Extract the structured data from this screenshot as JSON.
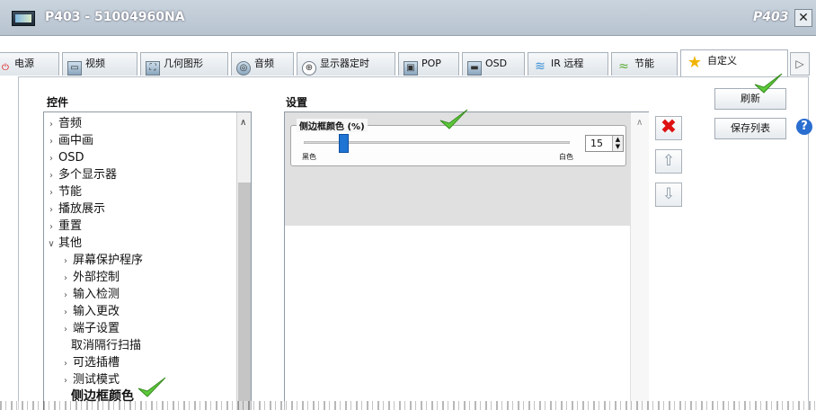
{
  "window": {
    "title": "P403 - 51004960NA",
    "model_label": "P403",
    "close_glyph": "✕"
  },
  "tabs": [
    {
      "label": "电源",
      "icon": "power-icon",
      "glyph": "⏻"
    },
    {
      "label": "视频",
      "icon": "video-icon",
      "glyph": "▭"
    },
    {
      "label": "几何图形",
      "icon": "geometry-icon",
      "glyph": "⛶"
    },
    {
      "label": "音频",
      "icon": "audio-icon",
      "glyph": "◎"
    },
    {
      "label": "显示器定时",
      "icon": "timer-icon",
      "glyph": "⊕"
    },
    {
      "label": "POP",
      "icon": "pop-icon",
      "glyph": "▣"
    },
    {
      "label": "OSD",
      "icon": "osd-icon",
      "glyph": "▬"
    },
    {
      "label": "IR 远程",
      "icon": "wifi-icon",
      "glyph": "≋"
    },
    {
      "label": "节能",
      "icon": "eco-icon",
      "glyph": "≈"
    },
    {
      "label": "自定义",
      "icon": "star-icon",
      "glyph": "★",
      "active": true
    }
  ],
  "tab_scroll_glyph": "▷",
  "controls_panel": {
    "title": "控件",
    "items": [
      {
        "label": "音频",
        "level": 0,
        "arrow": "›"
      },
      {
        "label": "画中画",
        "level": 0,
        "arrow": "›"
      },
      {
        "label": "OSD",
        "level": 0,
        "arrow": "›"
      },
      {
        "label": "多个显示器",
        "level": 0,
        "arrow": "›"
      },
      {
        "label": "节能",
        "level": 0,
        "arrow": "›"
      },
      {
        "label": "播放展示",
        "level": 0,
        "arrow": "›"
      },
      {
        "label": "重置",
        "level": 0,
        "arrow": "›"
      },
      {
        "label": "其他",
        "level": 0,
        "arrow": "∨"
      },
      {
        "label": "屏幕保护程序",
        "level": 1,
        "arrow": "›"
      },
      {
        "label": "外部控制",
        "level": 1,
        "arrow": "›"
      },
      {
        "label": "输入检测",
        "level": 1,
        "arrow": "›"
      },
      {
        "label": "输入更改",
        "level": 1,
        "arrow": "›"
      },
      {
        "label": "端子设置",
        "level": 1,
        "arrow": "›"
      },
      {
        "label": "取消隔行扫描",
        "level": 1,
        "arrow": ""
      },
      {
        "label": "可选插槽",
        "level": 1,
        "arrow": "›"
      },
      {
        "label": "测试模式",
        "level": 1,
        "arrow": "›"
      },
      {
        "label": "侧边框颜色",
        "level": 1,
        "arrow": "",
        "selected": true
      }
    ],
    "scroll_up_glyph": "∧"
  },
  "settings_panel": {
    "title": "设置",
    "slider": {
      "label": "侧边框颜色 (%)",
      "min_label": "黑色",
      "max_label": "白色",
      "value": "15",
      "value_fraction": 0.15
    },
    "scroll_up_glyph": "∧"
  },
  "side_buttons": {
    "delete_glyph": "✖",
    "up_glyph": "⇧",
    "down_glyph": "⇩"
  },
  "right_panel": {
    "refresh_label": "刷新",
    "save_list_label": "保存列表",
    "help_glyph": "?"
  },
  "colors": {
    "accent_blue": "#1f74d4",
    "delete_red": "#d11111",
    "check_green": "#5cc83a",
    "star_gold": "#f0b400"
  }
}
